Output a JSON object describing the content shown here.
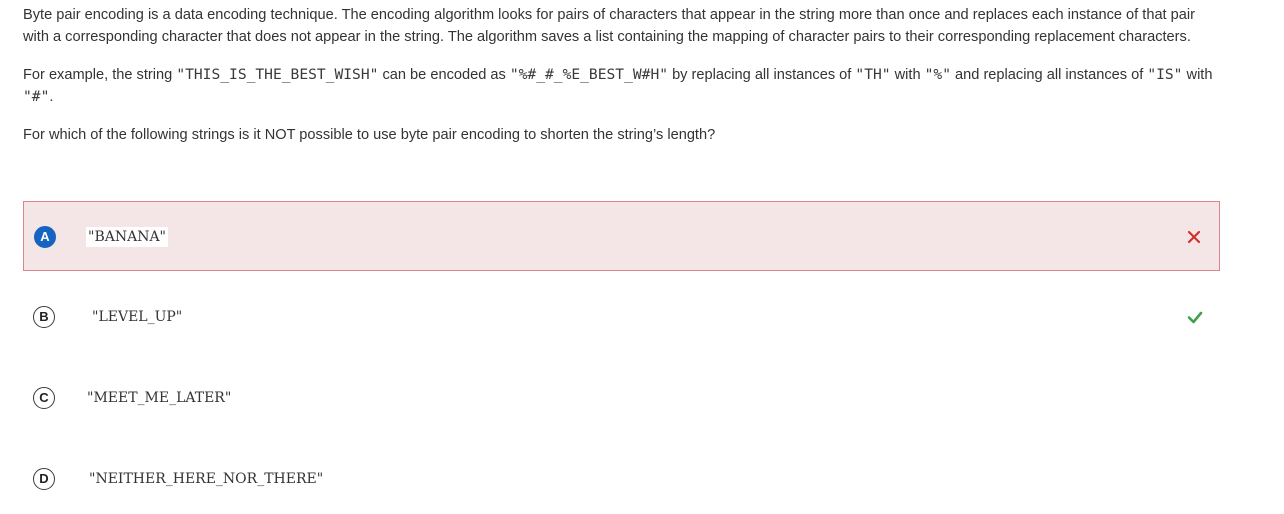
{
  "question": {
    "p1": "Byte pair encoding is a data encoding technique. The encoding algorithm looks for pairs of characters that appear in the string more than once and replaces each instance of that pair with a corresponding character that does not appear in the string. The algorithm saves a list containing the mapping of character pairs to their corresponding replacement characters.",
    "p2": {
      "t1": "For example, the string ",
      "c1": "\"THIS_IS_THE_BEST_WISH\"",
      "t2": " can be encoded as ",
      "c2": "\"%#_#_%E_BEST_W#H\"",
      "t3": " by replacing all instances of ",
      "c3": "\"TH\"",
      "t4": " with ",
      "c4": "\"%\"",
      "t5": " and replacing all instances of ",
      "c5": "\"IS\"",
      "t6": " with ",
      "c6": "\"#\"",
      "t7": "."
    },
    "p3": "For which of the following strings is it NOT possible to use byte pair encoding to shorten the string’s length?"
  },
  "options": [
    {
      "letter": "A",
      "text": "\"BANANA\"",
      "state": "selected-incorrect",
      "mark_icon": "x-icon"
    },
    {
      "letter": "B",
      "text": "\"LEVEL_UP\"",
      "state": "correct",
      "mark_icon": "check-icon"
    },
    {
      "letter": "C",
      "text": "\"MEET_ME_LATER\"",
      "state": "none"
    },
    {
      "letter": "D",
      "text": "\"NEITHER_HERE_NOR_THERE\"",
      "state": "none"
    }
  ],
  "colors": {
    "wrong_bg": "#f4e6e7",
    "wrong_border": "#d9868f",
    "x_mark": "#d32f2f",
    "check_mark": "#43a047",
    "selected_badge": "#1565c0"
  }
}
